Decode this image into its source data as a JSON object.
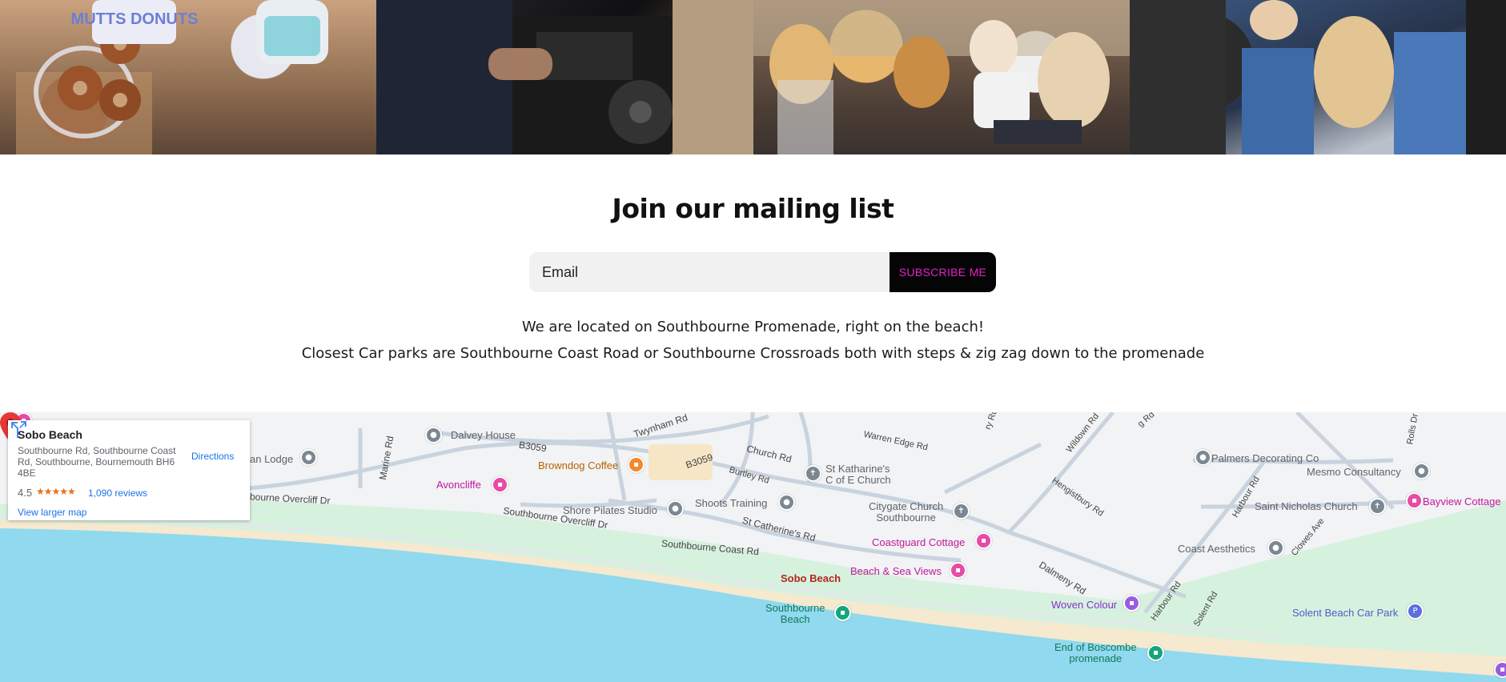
{
  "photos": [
    {
      "name": "photo-mutts-donuts",
      "caption": "MUTTS DONUTS"
    },
    {
      "name": "photo-dj"
    },
    {
      "name": "photo-dogs"
    },
    {
      "name": "photo-crowd"
    }
  ],
  "mailing": {
    "title": "Join our mailing list",
    "email_placeholder": "Email",
    "subscribe_label": "SUBSCRIBE ME",
    "location_line1": "We are located on Southbourne Promenade, right on the beach!",
    "location_line2": "Closest Car parks are Southbourne Coast Road or Southbourne Crossroads both with steps & zig zag down to the promenade"
  },
  "map_card": {
    "place_name": "Sobo Beach",
    "address": "Southbourne Rd, Southbourne Coast Rd, Southbourne, Bournemouth BH6 4BE",
    "rating": "4.5",
    "stars": "★★★★★",
    "reviews": "1,090 reviews",
    "directions": "Directions",
    "view_larger": "View larger map"
  },
  "map_labels": {
    "dalvey_house": "Dalvey House",
    "twynham_rd": "Twynham Rd",
    "b3059_a": "B3059",
    "b3059_b": "B3059",
    "browndog": "Browndog Coffee",
    "avoncliffe": "Avoncliffe",
    "an_lodge": "an Lodge",
    "marine_rd": "Marine Rd",
    "overcliff_1": "bourne Overcliff Dr",
    "overcliff_2": "Southbourne Overcliff Dr",
    "church_rd": "Church Rd",
    "burtley_rd": "Burtley Rd",
    "st_katharines": "St Katharine's\nC of E Church",
    "warren_edge": "Warren Edge Rd",
    "shore_pilates": "Shore Pilates Studio",
    "shoots_training": "Shoots Training",
    "citygate": "Citygate Church\nSouthbourne",
    "st_catherines": "St Catherine's Rd",
    "coast_rd": "Southbourne Coast Rd",
    "coastguard": "Coastguard Cottage",
    "beach_sea": "Beach & Sea Views",
    "sobo_beach": "Sobo Beach",
    "southbourne_beach": "Southbourne\nBeach",
    "palmers": "Palmers Decorating Co",
    "hengistbury": "Hengistbury Rd",
    "wildown": "Wildown Rd",
    "harbour_rd_1": "Harbour Rd",
    "harbour_rd_2": "Harbour Rd",
    "mesmo": "Mesmo Consultancy",
    "st_nicholas": "Saint Nicholas Church",
    "bayview": "Bayview Cottage",
    "coast_aesthetics": "Coast Aesthetics",
    "clowes_ave": "Clowes Ave",
    "dalmeny": "Dalmeny Rd",
    "woven_colour": "Woven Colour",
    "solent_rd": "Solent Rd",
    "solent_car_park": "Solent Beach Car Park",
    "end_boscombe": "End of Boscombe\npromenade",
    "rolls_dr": "Rolls Dr",
    "ry_rd": "ry Rd",
    "g_rd": "g Rd"
  }
}
